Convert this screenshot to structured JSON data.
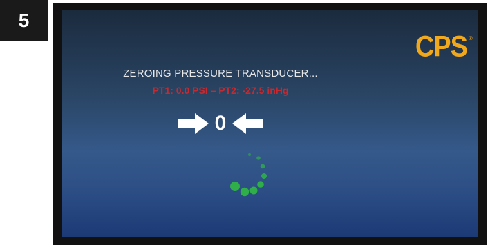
{
  "step": {
    "number": "5"
  },
  "brand": {
    "logo_text": "CPS",
    "registered": "®",
    "logo_color": "#f0a81c"
  },
  "screen": {
    "title": "ZEROING PRESSURE TRANSDUCER...",
    "readings": "PT1: 0.0 PSI – PT2: -27.5 inHg",
    "zero_value": "0",
    "readings_color": "#c62a2f",
    "spinner_color": "#2fae4a",
    "icons": [
      "arrow-right-icon",
      "arrow-left-icon",
      "loading-spinner-icon"
    ]
  }
}
